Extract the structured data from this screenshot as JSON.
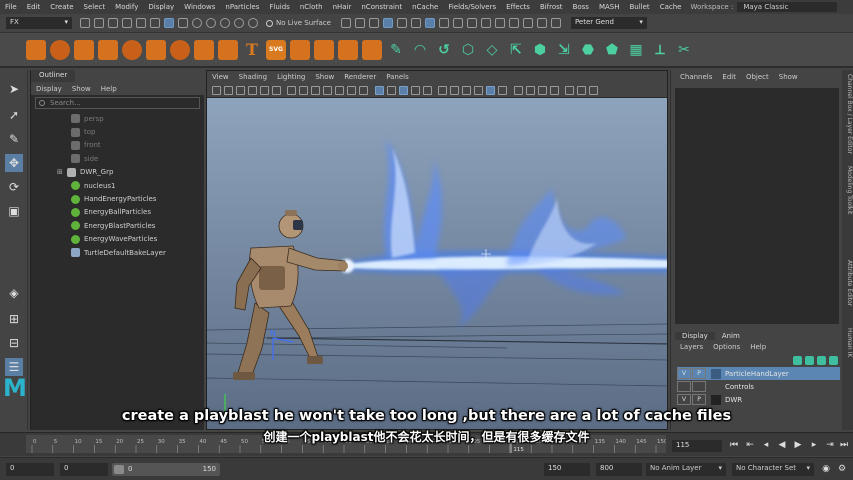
{
  "menu": {
    "items": [
      "File",
      "Edit",
      "Create",
      "Select",
      "Modify",
      "Display",
      "Windows",
      "nParticles",
      "Fluids",
      "nCloth",
      "nHair",
      "nConstraint",
      "nCache",
      "Fields/Solvers",
      "Effects",
      "Bifrost",
      "Boss",
      "MASH",
      "Bullet",
      "Cache"
    ],
    "workspace_label": "Workspace :",
    "workspace_value": "Maya Classic"
  },
  "statusline": {
    "menuset": "FX",
    "live_surface": "No Live Surface",
    "user": "Peter Gend"
  },
  "toolbar_shelf": {
    "icons": [
      "sphere-icon",
      "cube-icon",
      "cylinder-icon",
      "cone-icon",
      "torus-icon",
      "plane-icon",
      "disc-icon",
      "platonic-icon",
      "pipe-icon",
      "text-icon",
      "svg-icon",
      "sphere-alt-icon",
      "cylinder-alt-icon",
      "cube-alt-icon",
      "cube-outline-icon",
      "curve-icon",
      "curve-alt-icon",
      "curve-edit-icon",
      "shape-icon",
      "bend-icon",
      "bridge-icon",
      "loft-icon",
      "extrude-icon",
      "bevel-icon",
      "fill-icon",
      "merge-icon",
      "subdiv-icon",
      "cut-icon"
    ],
    "text_glyph": "T",
    "svg_label": "SVG"
  },
  "outliner": {
    "tab": "Outliner",
    "menu": [
      "Display",
      "Show",
      "Help"
    ],
    "search_placeholder": "Search...",
    "items": [
      {
        "label": "persp",
        "type": "camera",
        "dim": true
      },
      {
        "label": "top",
        "type": "camera",
        "dim": true
      },
      {
        "label": "front",
        "type": "camera",
        "dim": true
      },
      {
        "label": "side",
        "type": "camera",
        "dim": true
      },
      {
        "label": "DWR_Grp",
        "type": "group",
        "dim": false
      },
      {
        "label": "nucleus1",
        "type": "nucleus",
        "dim": false
      },
      {
        "label": "HandEnergyParticles",
        "type": "particle",
        "dim": false
      },
      {
        "label": "EnergyBallParticles",
        "type": "particle",
        "dim": false
      },
      {
        "label": "EnergyBlastParticles",
        "type": "particle",
        "dim": false
      },
      {
        "label": "EnergyWaveParticles",
        "type": "particle",
        "dim": false
      },
      {
        "label": "TurtleDefaultBakeLayer",
        "type": "turtle",
        "dim": false
      }
    ]
  },
  "viewport": {
    "menu": [
      "View",
      "Shading",
      "Lighting",
      "Show",
      "Renderer",
      "Panels"
    ],
    "axis_label": "N",
    "colors": {
      "sky_top": "#8ea3bc",
      "sky_bottom": "#5b6c84",
      "blast": "#cfe6ff",
      "blast_glow": "#3a7bff"
    }
  },
  "channelbox": {
    "menu": [
      "Channels",
      "Edit",
      "Object",
      "Show"
    ]
  },
  "sidetabs": [
    "Channel Box / Layer Editor",
    "Modeling Toolkit",
    "Attribute Editor",
    "Human IK"
  ],
  "layers": {
    "tabs": [
      "Display",
      "Anim"
    ],
    "menu": [
      "Layers",
      "Options",
      "Help"
    ],
    "rows": [
      {
        "v": "V",
        "p": "P",
        "name": "ParticleHandLayer",
        "selected": true,
        "color": "#3a5c80"
      },
      {
        "v": "",
        "p": "",
        "name": "Controls",
        "selected": false,
        "color": "#444444"
      },
      {
        "v": "V",
        "p": "P",
        "name": "DWR",
        "selected": false,
        "color": "#222222"
      }
    ]
  },
  "timeslider": {
    "ticks": [
      "0",
      "5",
      "10",
      "15",
      "20",
      "25",
      "30",
      "35",
      "40",
      "45",
      "50",
      "55",
      "60",
      "65",
      "70",
      "75",
      "80",
      "85",
      "90",
      "95",
      "100",
      "105",
      "110",
      "115",
      "120",
      "125",
      "130",
      "135",
      "140",
      "145",
      "150"
    ],
    "current_marker": "115",
    "current_frame": "115"
  },
  "rangebar": {
    "start": "0",
    "anim_start": "0",
    "range_start": "0",
    "range_end": "150",
    "anim_end": "150",
    "end": "800",
    "anim_layer": "No Anim Layer",
    "character_set": "No Character Set"
  },
  "subtitles": {
    "en": "create a playblast he won't take too long ,but there are a lot of cache files",
    "zh": "创建一个playblast他不会花太长时间，但是有很多缓存文件"
  }
}
